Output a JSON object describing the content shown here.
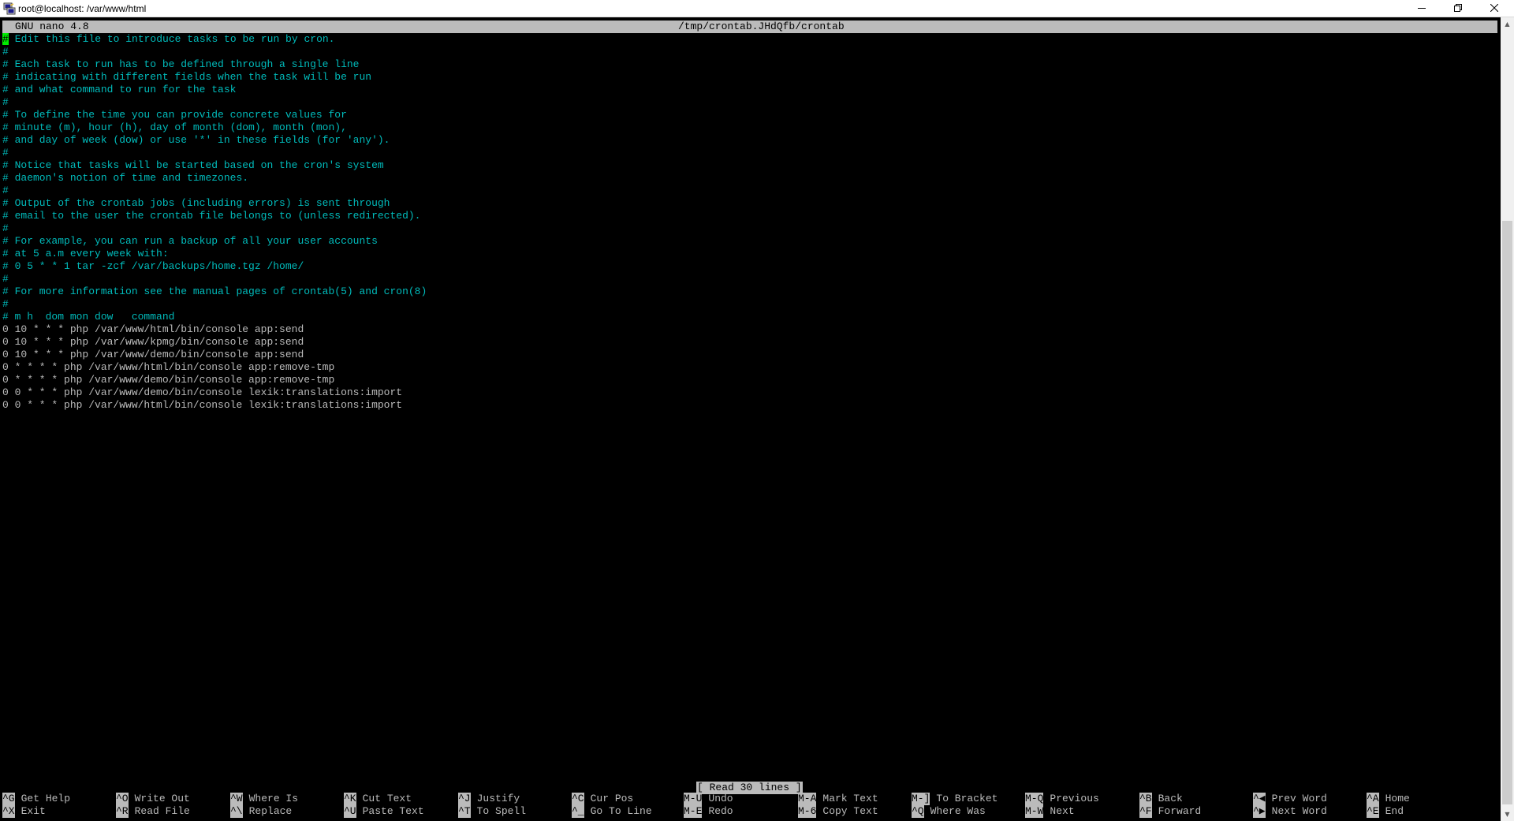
{
  "window": {
    "title": "root@localhost: /var/www/html",
    "icons": [
      "putty-icon",
      "minimize-icon",
      "maximize-icon",
      "close-icon"
    ]
  },
  "nano": {
    "version": "GNU nano 4.8",
    "filename": "/tmp/crontab.JHdQfb/crontab"
  },
  "lines": [
    {
      "text": "# Edit this file to introduce tasks to be run by cron.",
      "type": "comment"
    },
    {
      "text": "#",
      "type": "comment"
    },
    {
      "text": "# Each task to run has to be defined through a single line",
      "type": "comment"
    },
    {
      "text": "# indicating with different fields when the task will be run",
      "type": "comment"
    },
    {
      "text": "# and what command to run for the task",
      "type": "comment"
    },
    {
      "text": "#",
      "type": "comment"
    },
    {
      "text": "# To define the time you can provide concrete values for",
      "type": "comment"
    },
    {
      "text": "# minute (m), hour (h), day of month (dom), month (mon),",
      "type": "comment"
    },
    {
      "text": "# and day of week (dow) or use '*' in these fields (for 'any').",
      "type": "comment"
    },
    {
      "text": "#",
      "type": "comment"
    },
    {
      "text": "# Notice that tasks will be started based on the cron's system",
      "type": "comment"
    },
    {
      "text": "# daemon's notion of time and timezones.",
      "type": "comment"
    },
    {
      "text": "#",
      "type": "comment"
    },
    {
      "text": "# Output of the crontab jobs (including errors) is sent through",
      "type": "comment"
    },
    {
      "text": "# email to the user the crontab file belongs to (unless redirected).",
      "type": "comment"
    },
    {
      "text": "#",
      "type": "comment"
    },
    {
      "text": "# For example, you can run a backup of all your user accounts",
      "type": "comment"
    },
    {
      "text": "# at 5 a.m every week with:",
      "type": "comment"
    },
    {
      "text": "# 0 5 * * 1 tar -zcf /var/backups/home.tgz /home/",
      "type": "comment"
    },
    {
      "text": "#",
      "type": "comment"
    },
    {
      "text": "# For more information see the manual pages of crontab(5) and cron(8)",
      "type": "comment"
    },
    {
      "text": "#",
      "type": "comment"
    },
    {
      "text": "# m h  dom mon dow   command",
      "type": "comment"
    },
    {
      "text": "0 10 * * * php /var/www/html/bin/console app:send",
      "type": "plain"
    },
    {
      "text": "0 10 * * * php /var/www/kpmg/bin/console app:send",
      "type": "plain"
    },
    {
      "text": "0 10 * * * php /var/www/demo/bin/console app:send",
      "type": "plain"
    },
    {
      "text": "0 * * * * php /var/www/html/bin/console app:remove-tmp",
      "type": "plain"
    },
    {
      "text": "0 * * * * php /var/www/demo/bin/console app:remove-tmp",
      "type": "plain"
    },
    {
      "text": "0 0 * * * php /var/www/demo/bin/console lexik:translations:import",
      "type": "plain"
    },
    {
      "text": "0 0 * * * php /var/www/html/bin/console lexik:translations:import",
      "type": "plain"
    }
  ],
  "status": "[ Read 30 lines ]",
  "shortcuts_row1": [
    {
      "key": "^G",
      "label": "Get Help"
    },
    {
      "key": "^O",
      "label": "Write Out"
    },
    {
      "key": "^W",
      "label": "Where Is"
    },
    {
      "key": "^K",
      "label": "Cut Text"
    },
    {
      "key": "^J",
      "label": "Justify"
    },
    {
      "key": "^C",
      "label": "Cur Pos"
    },
    {
      "key": "M-U",
      "label": "Undo"
    },
    {
      "key": "M-A",
      "label": "Mark Text"
    },
    {
      "key": "M-]",
      "label": "To Bracket"
    },
    {
      "key": "M-Q",
      "label": "Previous"
    },
    {
      "key": "^B",
      "label": "Back"
    },
    {
      "key": "^◀",
      "label": "Prev Word"
    },
    {
      "key": "^A",
      "label": "Home"
    }
  ],
  "shortcuts_row2": [
    {
      "key": "^X",
      "label": "Exit"
    },
    {
      "key": "^R",
      "label": "Read File"
    },
    {
      "key": "^\\",
      "label": "Replace"
    },
    {
      "key": "^U",
      "label": "Paste Text"
    },
    {
      "key": "^T",
      "label": "To Spell"
    },
    {
      "key": "^_",
      "label": "Go To Line"
    },
    {
      "key": "M-E",
      "label": "Redo"
    },
    {
      "key": "M-6",
      "label": "Copy Text"
    },
    {
      "key": "^Q",
      "label": "Where Was"
    },
    {
      "key": "M-W",
      "label": "Next"
    },
    {
      "key": "^F",
      "label": "Forward"
    },
    {
      "key": "^▶",
      "label": "Next Word"
    },
    {
      "key": "^E",
      "label": "End"
    }
  ],
  "colors": {
    "background": "#000000",
    "comment": "#00bbbb",
    "text": "#bbbbbb",
    "inverse_bg": "#bbbbbb",
    "cursor": "#00ee00"
  }
}
